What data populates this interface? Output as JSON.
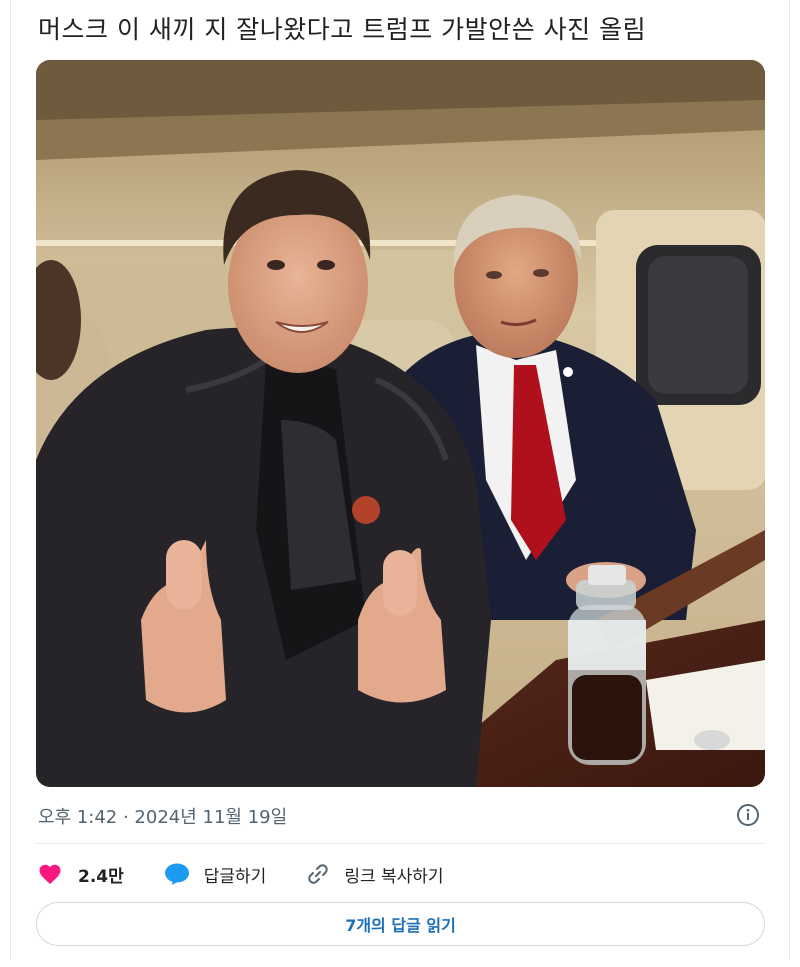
{
  "post": {
    "headline": "머스크 이 새끼 지 잘나왔다고 트럼프 가발안쓴 사진 올림",
    "timestamp": "오후 1:42 · 2024년 11월 19일"
  },
  "actions": {
    "like_count": "2.4만",
    "reply_label": "답글하기",
    "copy_link_label": "링크 복사하기"
  },
  "read_replies_label": "7개의 답글 읽기",
  "icons": {
    "like": "heart-icon",
    "reply": "speech-bubble-icon",
    "copy_link": "link-icon",
    "info": "info-icon"
  },
  "colors": {
    "like": "#f91880",
    "reply": "#1d9bf0",
    "read_replies": "#1d6fb8"
  }
}
